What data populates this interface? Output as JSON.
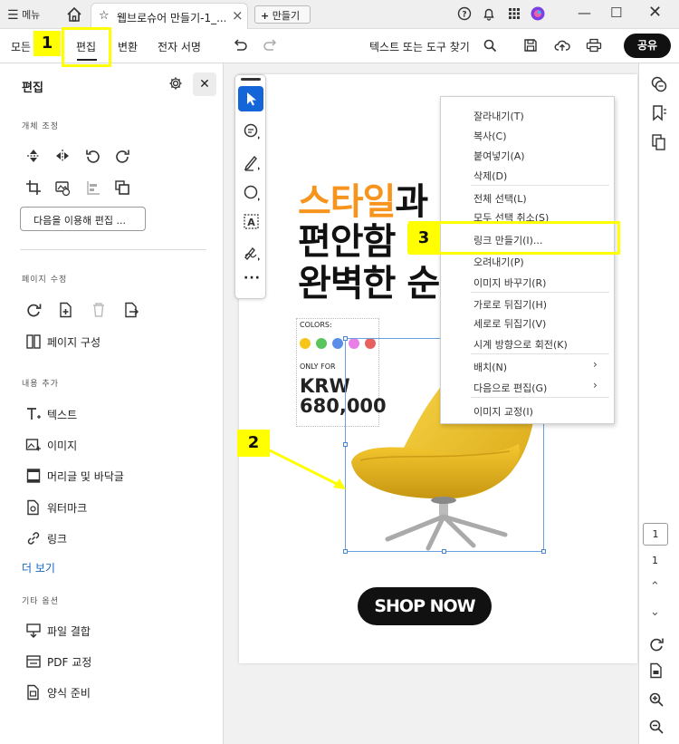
{
  "titlebar": {
    "menu_label": "메뉴",
    "tab_title": "웹브로슈어 만들기-1_...",
    "new_label": "만들기"
  },
  "toolbar": {
    "items": [
      "모든",
      "편집",
      "변환",
      "전자 서명"
    ],
    "search_label": "텍스트 또는 도구 찾기",
    "share_label": "공유"
  },
  "left_panel": {
    "title": "편집",
    "sections": {
      "object": "개체 조정",
      "page": "페이지 수정",
      "content": "내용 추가",
      "other": "기타 옵션"
    },
    "edit_with_label": "다음을 이용해 편집 ...",
    "page_organize": "페이지 구성",
    "content_items": [
      "텍스트",
      "이미지",
      "머리글 및 바닥글",
      "워터마크",
      "링크"
    ],
    "more_label": "더 보기",
    "other_items": [
      "파일 결합",
      "PDF 교정",
      "양식 준비"
    ]
  },
  "document": {
    "headline_orange": "스타일",
    "headline_line1_rest": "과",
    "headline_line2": "편안함",
    "headline_line3": "완벽한 순",
    "colors_label": "COLORS:",
    "color_dots": [
      "#f5c518",
      "#5cc45c",
      "#5a8ee8",
      "#e87ee8",
      "#e86060"
    ],
    "only_for": "ONLY FOR",
    "price_currency": "KRW",
    "price_value": "680,000",
    "cta": "SHOP NOW"
  },
  "context_menu": {
    "items": [
      "잘라내기(T)",
      "복사(C)",
      "붙여넣기(A)",
      "삭제(D)",
      "전체 선택(L)",
      "모두 선택 취소(S)",
      "링크 만들기(I)...",
      "오려내기(P)",
      "이미지 바꾸기(R)",
      "가로로 뒤집기(H)",
      "세로로 뒤집기(V)",
      "시계 방향으로 회전(K)",
      "배치(N)",
      "다음으로 편집(G)",
      "이미지 교정(I)"
    ]
  },
  "right_panel": {
    "page_box": "1",
    "page_count": "1"
  },
  "annotations": {
    "step1": "1",
    "step2": "2",
    "step3": "3",
    "highlight_color": "#ffff00"
  }
}
